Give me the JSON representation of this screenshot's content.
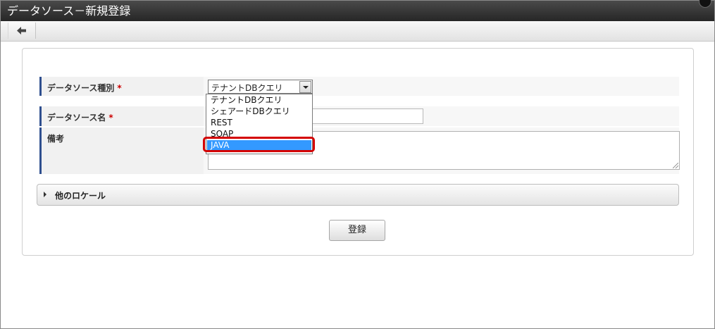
{
  "window": {
    "title": "データソース－新規登録"
  },
  "toolbar": {
    "back_icon": "arrow-left-icon"
  },
  "form": {
    "type_label": "データソース種別",
    "name_label": "データソース名",
    "note_label": "備考",
    "required_mark": "*",
    "type_selected": "テナントDBクエリ",
    "name_value": "",
    "note_value": ""
  },
  "dropdown": {
    "options": [
      "テナントDBクエリ",
      "シェアードDBクエリ",
      "REST",
      "SOAP",
      "JAVA"
    ],
    "selected_index": 4,
    "highlight_color": "#d40000",
    "selected_color": "#3399ff"
  },
  "locale_section": {
    "label": "他のロケール"
  },
  "actions": {
    "submit_label": "登録"
  }
}
